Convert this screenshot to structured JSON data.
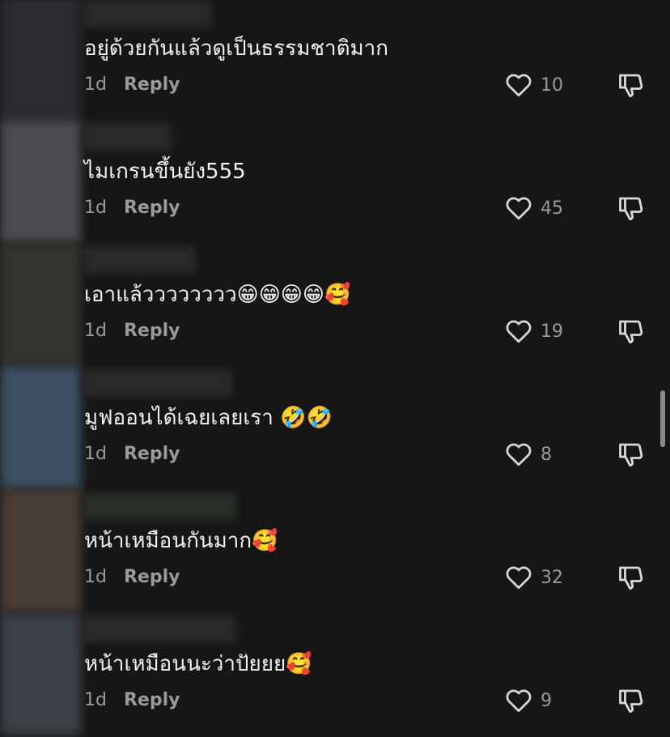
{
  "comments": [
    {
      "text": "อยู่ด้วยกันแล้วดูเป็นธรรมชาติมาก",
      "time": "1d",
      "reply_label": "Reply",
      "likes": "10"
    },
    {
      "text": "ไมเกรนขึ้นยัง555",
      "time": "1d",
      "reply_label": "Reply",
      "likes": "45"
    },
    {
      "text": "เอาแล้วววววววว😁😁😁😁🥰",
      "time": "1d",
      "reply_label": "Reply",
      "likes": "19"
    },
    {
      "text": "มูฟออนได้เฉยเลยเรา 🤣🤣",
      "time": "1d",
      "reply_label": "Reply",
      "likes": "8"
    },
    {
      "text": "หน้าเหมือนกันมาก🥰",
      "time": "1d",
      "reply_label": "Reply",
      "likes": "32"
    },
    {
      "text": "หน้าเหมือนนะว่าปัยยย🥰",
      "time": "1d",
      "reply_label": "Reply",
      "likes": "9"
    }
  ],
  "icons": {
    "like": "heart-outline-icon",
    "dislike": "thumbs-down-icon"
  },
  "colors": {
    "background": "#161616",
    "text": "#f2f2f2",
    "secondary": "#9a9a9a"
  }
}
